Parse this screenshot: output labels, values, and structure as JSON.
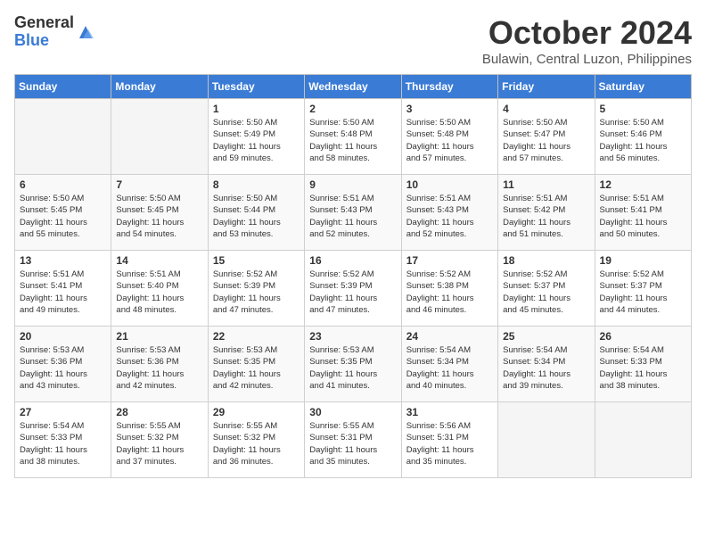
{
  "logo": {
    "general": "General",
    "blue": "Blue"
  },
  "title": "October 2024",
  "location": "Bulawin, Central Luzon, Philippines",
  "headers": [
    "Sunday",
    "Monday",
    "Tuesday",
    "Wednesday",
    "Thursday",
    "Friday",
    "Saturday"
  ],
  "weeks": [
    [
      {
        "day": "",
        "info": ""
      },
      {
        "day": "",
        "info": ""
      },
      {
        "day": "1",
        "info": "Sunrise: 5:50 AM\nSunset: 5:49 PM\nDaylight: 11 hours\nand 59 minutes."
      },
      {
        "day": "2",
        "info": "Sunrise: 5:50 AM\nSunset: 5:48 PM\nDaylight: 11 hours\nand 58 minutes."
      },
      {
        "day": "3",
        "info": "Sunrise: 5:50 AM\nSunset: 5:48 PM\nDaylight: 11 hours\nand 57 minutes."
      },
      {
        "day": "4",
        "info": "Sunrise: 5:50 AM\nSunset: 5:47 PM\nDaylight: 11 hours\nand 57 minutes."
      },
      {
        "day": "5",
        "info": "Sunrise: 5:50 AM\nSunset: 5:46 PM\nDaylight: 11 hours\nand 56 minutes."
      }
    ],
    [
      {
        "day": "6",
        "info": "Sunrise: 5:50 AM\nSunset: 5:45 PM\nDaylight: 11 hours\nand 55 minutes."
      },
      {
        "day": "7",
        "info": "Sunrise: 5:50 AM\nSunset: 5:45 PM\nDaylight: 11 hours\nand 54 minutes."
      },
      {
        "day": "8",
        "info": "Sunrise: 5:50 AM\nSunset: 5:44 PM\nDaylight: 11 hours\nand 53 minutes."
      },
      {
        "day": "9",
        "info": "Sunrise: 5:51 AM\nSunset: 5:43 PM\nDaylight: 11 hours\nand 52 minutes."
      },
      {
        "day": "10",
        "info": "Sunrise: 5:51 AM\nSunset: 5:43 PM\nDaylight: 11 hours\nand 52 minutes."
      },
      {
        "day": "11",
        "info": "Sunrise: 5:51 AM\nSunset: 5:42 PM\nDaylight: 11 hours\nand 51 minutes."
      },
      {
        "day": "12",
        "info": "Sunrise: 5:51 AM\nSunset: 5:41 PM\nDaylight: 11 hours\nand 50 minutes."
      }
    ],
    [
      {
        "day": "13",
        "info": "Sunrise: 5:51 AM\nSunset: 5:41 PM\nDaylight: 11 hours\nand 49 minutes."
      },
      {
        "day": "14",
        "info": "Sunrise: 5:51 AM\nSunset: 5:40 PM\nDaylight: 11 hours\nand 48 minutes."
      },
      {
        "day": "15",
        "info": "Sunrise: 5:52 AM\nSunset: 5:39 PM\nDaylight: 11 hours\nand 47 minutes."
      },
      {
        "day": "16",
        "info": "Sunrise: 5:52 AM\nSunset: 5:39 PM\nDaylight: 11 hours\nand 47 minutes."
      },
      {
        "day": "17",
        "info": "Sunrise: 5:52 AM\nSunset: 5:38 PM\nDaylight: 11 hours\nand 46 minutes."
      },
      {
        "day": "18",
        "info": "Sunrise: 5:52 AM\nSunset: 5:37 PM\nDaylight: 11 hours\nand 45 minutes."
      },
      {
        "day": "19",
        "info": "Sunrise: 5:52 AM\nSunset: 5:37 PM\nDaylight: 11 hours\nand 44 minutes."
      }
    ],
    [
      {
        "day": "20",
        "info": "Sunrise: 5:53 AM\nSunset: 5:36 PM\nDaylight: 11 hours\nand 43 minutes."
      },
      {
        "day": "21",
        "info": "Sunrise: 5:53 AM\nSunset: 5:36 PM\nDaylight: 11 hours\nand 42 minutes."
      },
      {
        "day": "22",
        "info": "Sunrise: 5:53 AM\nSunset: 5:35 PM\nDaylight: 11 hours\nand 42 minutes."
      },
      {
        "day": "23",
        "info": "Sunrise: 5:53 AM\nSunset: 5:35 PM\nDaylight: 11 hours\nand 41 minutes."
      },
      {
        "day": "24",
        "info": "Sunrise: 5:54 AM\nSunset: 5:34 PM\nDaylight: 11 hours\nand 40 minutes."
      },
      {
        "day": "25",
        "info": "Sunrise: 5:54 AM\nSunset: 5:34 PM\nDaylight: 11 hours\nand 39 minutes."
      },
      {
        "day": "26",
        "info": "Sunrise: 5:54 AM\nSunset: 5:33 PM\nDaylight: 11 hours\nand 38 minutes."
      }
    ],
    [
      {
        "day": "27",
        "info": "Sunrise: 5:54 AM\nSunset: 5:33 PM\nDaylight: 11 hours\nand 38 minutes."
      },
      {
        "day": "28",
        "info": "Sunrise: 5:55 AM\nSunset: 5:32 PM\nDaylight: 11 hours\nand 37 minutes."
      },
      {
        "day": "29",
        "info": "Sunrise: 5:55 AM\nSunset: 5:32 PM\nDaylight: 11 hours\nand 36 minutes."
      },
      {
        "day": "30",
        "info": "Sunrise: 5:55 AM\nSunset: 5:31 PM\nDaylight: 11 hours\nand 35 minutes."
      },
      {
        "day": "31",
        "info": "Sunrise: 5:56 AM\nSunset: 5:31 PM\nDaylight: 11 hours\nand 35 minutes."
      },
      {
        "day": "",
        "info": ""
      },
      {
        "day": "",
        "info": ""
      }
    ]
  ]
}
